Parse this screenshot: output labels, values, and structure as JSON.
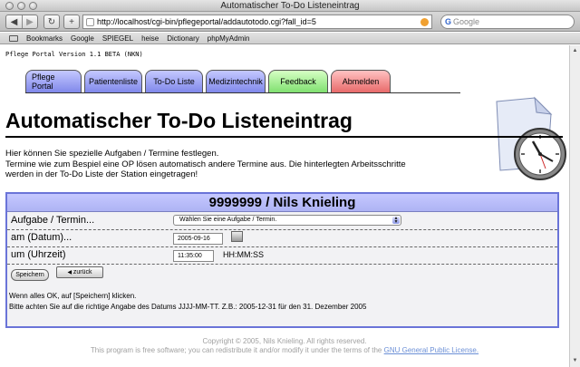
{
  "window": {
    "title": "Automatischer To-Do Listeneintrag"
  },
  "toolbar": {
    "url": "http://localhost/cgi-bin/pflegeportal/addautotodo.cgi?fall_id=5",
    "search_placeholder": "Google"
  },
  "bookmarks": [
    "Bookmarks",
    "Google",
    "SPIEGEL",
    "heise",
    "Dictionary",
    "phpMyAdmin"
  ],
  "page": {
    "version": "Pflege Portal Version 1.1 BETA (NKN)",
    "tabs": [
      "Pflege Portal",
      "Patientenliste",
      "To-Do Liste",
      "Medizintechnik",
      "Feedback",
      "Abmelden"
    ],
    "heading": "Automatischer To-Do Listeneintrag",
    "intro_1": "Hier können Sie spezielle Aufgaben / Termine festlegen.",
    "intro_2": "Termine wie zum Bespiel eine OP lösen automatisch andere Termine aus. Die hinterlegten Arbeitsschritte",
    "intro_3": "werden in der To-Do Liste der Station eingetragen!"
  },
  "form": {
    "patient": "9999999 / Nils Knieling",
    "task_label": "Aufgabe / Termin...",
    "task_select": "Wählen Sie eine Aufgabe / Termin.",
    "date_label": "am (Datum)...",
    "date_value": "2005-09-16",
    "time_label": "um (Uhrzeit)",
    "time_value": "11:35:00",
    "time_format": "HH:MM:SS",
    "save_button": "Speichern",
    "back_button": "zurück",
    "hint_1": "Wenn alles OK, auf [Speichern] klicken.",
    "hint_2": "Bitte achten Sie auf die richtige Angabe des Datums JJJJ-MM-TT. Z.B.: 2005-12-31 für den 31. Dezember 2005"
  },
  "footer": {
    "copyright": "Copyright © 2005, Nils Knieling. All rights reserved.",
    "license_text": "This program is free software; you can redistribute it and/or modify it under the terms of the",
    "license_link": "GNU General Public License."
  },
  "colors": {
    "tab_blue": "#8088ea",
    "tab_green": "#80e070",
    "tab_red": "#e86a6a",
    "form_border": "#6a74d8",
    "link": "#6b8fd6"
  },
  "icons": [
    "back-arrow-icon",
    "forward-arrow-icon",
    "reload-icon",
    "add-icon",
    "rss-icon",
    "search-icon",
    "bookmarks-book-icon",
    "clock-icon",
    "calendar-icon"
  ]
}
